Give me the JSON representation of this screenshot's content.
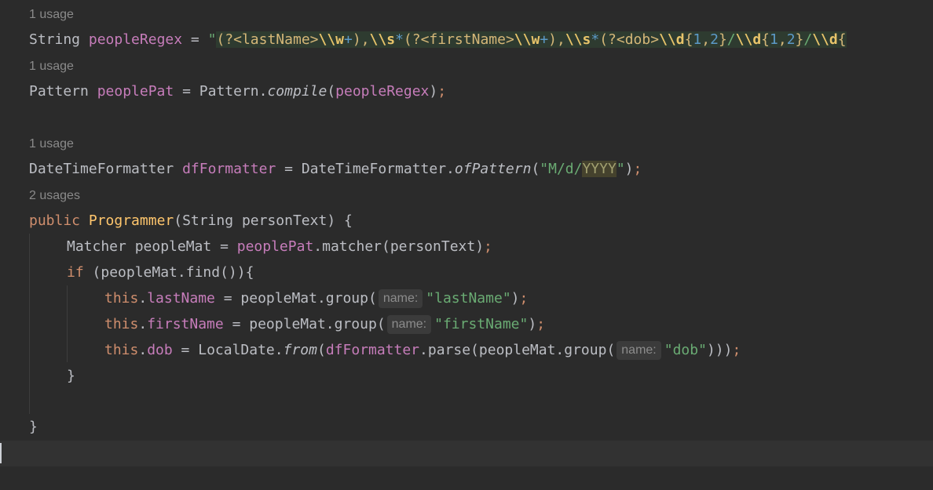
{
  "hints": {
    "usage_1": "1 usage",
    "usage_2": "1 usage",
    "usage_3": "1 usage",
    "usage_4": "2 usages"
  },
  "line1": {
    "type": "String",
    "var": "peopleRegex",
    "eq": " = ",
    "quote": "\"",
    "r1": "(?<lastName>",
    "r2": "\\\\w",
    "r3": "+",
    "r4": "),",
    "r5": "\\\\s",
    "r6": "*",
    "r7": "(?<firstName>",
    "r8": "\\\\w",
    "r9": "+",
    "r10": "),",
    "r11": "\\\\s",
    "r12": "*",
    "r13": "(?<dob>",
    "r14": "\\\\d",
    "r15": "{",
    "r16": "1",
    "r17": ",",
    "r18": "2",
    "r19": "}",
    "r20": "/",
    "r21": "\\\\d",
    "r22": "{",
    "r23": "1",
    "r24": ",",
    "r25": "2",
    "r26": "}",
    "r27": "/",
    "r28": "\\\\d",
    "r29": "{"
  },
  "line2": {
    "type": "Pattern",
    "var": "peoplePat",
    "eq": " = ",
    "cls": "Pattern.",
    "method": "compile",
    "open": "(",
    "arg": "peopleRegex",
    "close": ")",
    "semi": ";"
  },
  "line3": {
    "type": "DateTimeFormatter",
    "var": "dfFormatter",
    "eq": " = ",
    "cls": "DateTimeFormatter.",
    "method": "ofPattern",
    "open": "(",
    "str1": "\"M/d/",
    "str_hl": "YYYY",
    "str2": "\"",
    "close": ")",
    "semi": ";"
  },
  "line4": {
    "kw": "public",
    "name": "Programmer",
    "params": "(String personText) {"
  },
  "line5": {
    "text1": "Matcher peopleMat = ",
    "field": "peoplePat",
    "text2": ".matcher(personText)",
    "semi": ";"
  },
  "line6": {
    "kw": "if",
    "text": " (peopleMat.find()){"
  },
  "line7": {
    "kw": "this",
    "dot": ".",
    "field": "lastName",
    "text": " = peopleMat.group(",
    "hint": "name:",
    "str": "\"lastName\"",
    "close": ")",
    "semi": ";"
  },
  "line8": {
    "kw": "this",
    "dot": ".",
    "field": "firstName",
    "text": " = peopleMat.group(",
    "hint": "name:",
    "str": "\"firstName\"",
    "close": ")",
    "semi": ";"
  },
  "line9": {
    "kw": "this",
    "dot": ".",
    "field": "dob",
    "text1": " = LocalDate.",
    "method": "from",
    "open": "(",
    "field2": "dfFormatter",
    "text2": ".parse(peopleMat.group(",
    "hint": "name:",
    "str": "\"dob\"",
    "close": ")))",
    "semi": ";"
  },
  "line10": {
    "brace": "}"
  },
  "line12": {
    "brace": "}"
  }
}
